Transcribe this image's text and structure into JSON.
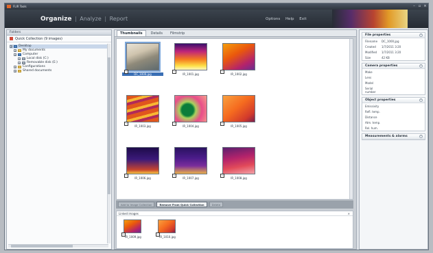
{
  "titlebar": {
    "title": "FLIR Tools"
  },
  "modes": {
    "organize": "Organize",
    "analyze": "Analyze",
    "report": "Report",
    "separator": "|"
  },
  "topmenu": {
    "options": "Options",
    "help": "Help",
    "exit": "Exit"
  },
  "left_panel": {
    "header": "Folders",
    "collection": "Quick Collection (9 images)",
    "tree": [
      {
        "label": "Desktop",
        "level": 0,
        "icon": "desktop-icon"
      },
      {
        "label": "My documents",
        "level": 1,
        "icon": "folder-icon"
      },
      {
        "label": "Computer",
        "level": 1,
        "icon": "computer-icon"
      },
      {
        "label": "Local disk (C:)",
        "level": 2,
        "icon": "drive-icon"
      },
      {
        "label": "Removable disk (E:)",
        "level": 2,
        "icon": "drive-icon"
      },
      {
        "label": "Configurations",
        "level": 1,
        "icon": "folder-icon"
      },
      {
        "label": "Shared documents",
        "level": 1,
        "icon": "folder-icon"
      }
    ]
  },
  "center": {
    "tabs": [
      "Thumbnails",
      "Details",
      "Filmstrip"
    ],
    "active_tab": "Thumbnails",
    "thumbnails": [
      {
        "caption": "DC_1000.jpg",
        "palette": "photo",
        "selected": true
      },
      {
        "caption": "IR_1001.jpg",
        "palette": "iron-hot"
      },
      {
        "caption": "IR_1002.jpg",
        "palette": "iron-warm"
      },
      {
        "caption": "IR_1003.jpg",
        "palette": "iron-stripes"
      },
      {
        "caption": "IR_1004.jpg",
        "palette": "rainbow"
      },
      {
        "caption": "IR_1005.jpg",
        "palette": "iron-orange"
      },
      {
        "caption": "IR_1006.jpg",
        "palette": "iron-tower"
      },
      {
        "caption": "IR_1007.jpg",
        "palette": "iron-pylon"
      },
      {
        "caption": "IR_1008.jpg",
        "palette": "iron-machine"
      }
    ],
    "actions": [
      "Add to Image Collection",
      "Remove From Quick Collection",
      "Delete"
    ],
    "linked": {
      "header": "Linked images",
      "items": [
        {
          "caption": "IR_1009.jpg",
          "palette": "iron-warm"
        },
        {
          "caption": "IR_1010.jpg",
          "palette": "iron-orange"
        }
      ]
    }
  },
  "right_panel": {
    "sections": [
      {
        "title": "File properties",
        "rows": [
          {
            "k": "Filename",
            "v": "DC_1000.jpg"
          },
          {
            "k": "Created",
            "v": "1/7/2011 3:20"
          },
          {
            "k": "Modified",
            "v": "1/7/2011 3:20"
          },
          {
            "k": "Size",
            "v": "42 KB"
          }
        ]
      },
      {
        "title": "Camera properties",
        "rows": [
          {
            "k": "Make",
            "v": ""
          },
          {
            "k": "Lens",
            "v": ""
          },
          {
            "k": "Model",
            "v": ""
          },
          {
            "k": "Serial number",
            "v": ""
          }
        ]
      },
      {
        "title": "Object properties",
        "rows": [
          {
            "k": "Emissivity",
            "v": ""
          },
          {
            "k": "Refl. temp.",
            "v": ""
          },
          {
            "k": "Distance",
            "v": ""
          },
          {
            "k": "Atm. temp.",
            "v": ""
          },
          {
            "k": "Rel. hum.",
            "v": ""
          }
        ]
      },
      {
        "title": "Measurements & alarms",
        "rows": []
      }
    ]
  },
  "colors": {
    "accent": "#3a6fb5",
    "titlebar": "#2e353e",
    "thermal_orange": "#e2672a"
  }
}
